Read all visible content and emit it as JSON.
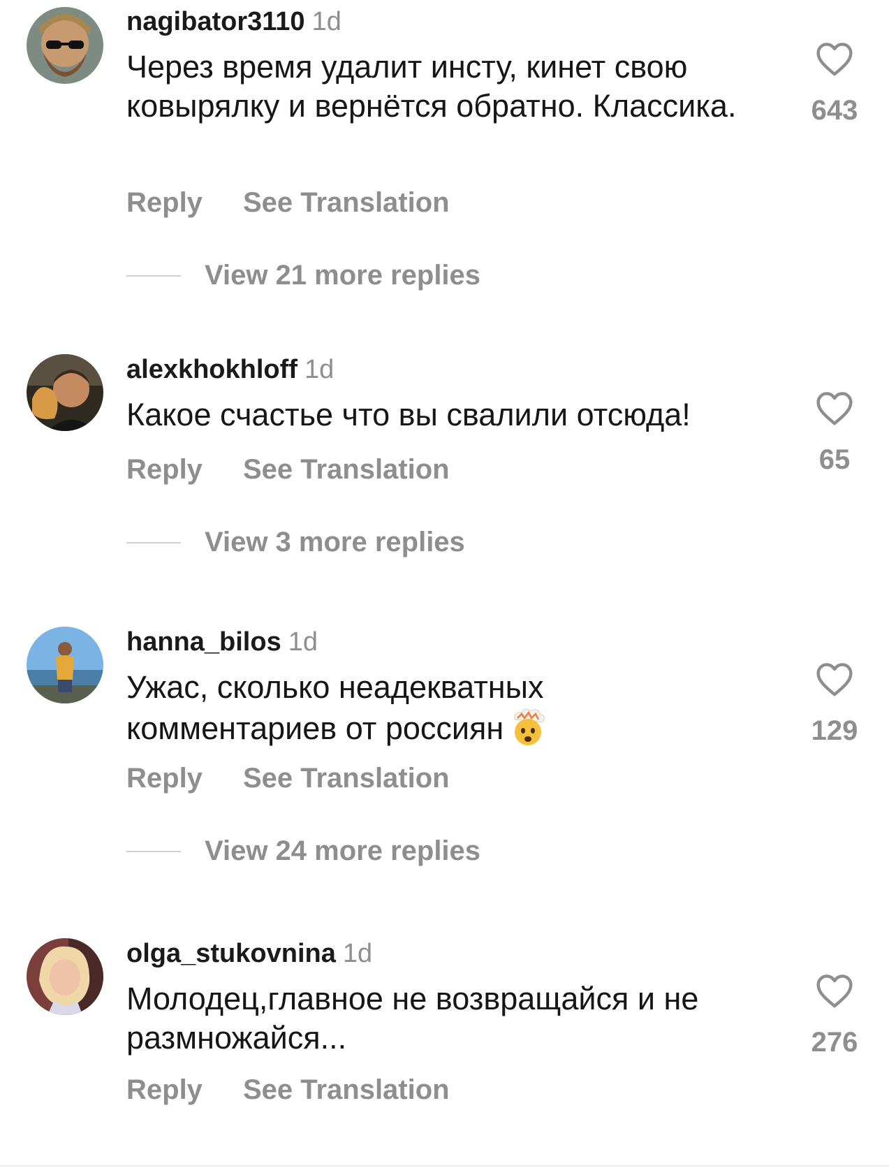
{
  "colors": {
    "text": "#161616",
    "muted": "#8e8e8e",
    "divider": "#d0d0d0",
    "background": "#ffffff"
  },
  "icons": {
    "like": "heart-outline-icon",
    "emoji": "exploding-head-emoji"
  },
  "comments": [
    {
      "username": "nagibator3110",
      "time": "1d",
      "text": "Через время удалит инсту, кинет свою ковырялку и вернётся обратно. Классика.",
      "likes": "643",
      "reply_label": "Reply",
      "translate_label": "See Translation",
      "more_replies": "View 21 more replies"
    },
    {
      "username": "alexkhokhloff",
      "time": "1d",
      "text": "Какое счастье что вы свалили отсюда!",
      "likes": "65",
      "reply_label": "Reply",
      "translate_label": "See Translation",
      "more_replies": "View 3 more replies"
    },
    {
      "username": "hanna_bilos",
      "time": "1d",
      "text": "Ужас, сколько неадекватных комментариев от россиян",
      "emoji": "🤯",
      "likes": "129",
      "reply_label": "Reply",
      "translate_label": "See Translation",
      "more_replies": "View 24 more replies"
    },
    {
      "username": "olga_stukovnina",
      "time": "1d",
      "text": "Молодец,главное не возвращайся и не размножайся...",
      "likes": "276",
      "reply_label": "Reply",
      "translate_label": "See Translation"
    }
  ]
}
